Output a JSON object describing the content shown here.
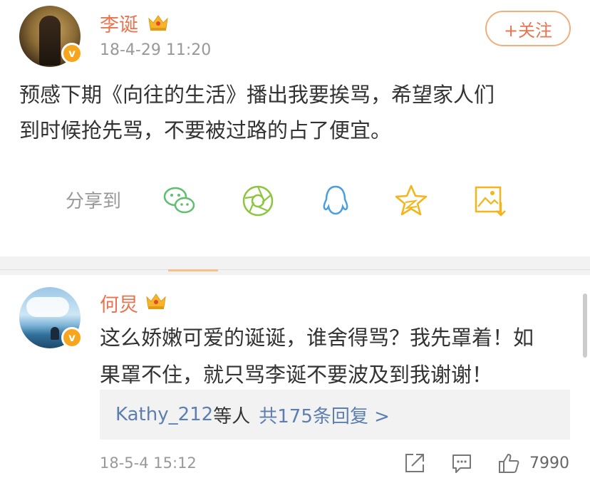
{
  "post": {
    "username": "李诞",
    "time": "18-4-29 11:20",
    "follow_label": "+关注",
    "text_line1": "预感下期《向往的生活》播出我要挨骂，希望家人们",
    "text_line2": "到时候抢先骂，不要被过路的占了便宜。",
    "verified_mark": "v",
    "share_label": "分享到",
    "share_icons": [
      "wechat-icon",
      "moments-icon",
      "qq-icon",
      "qzone-icon",
      "save-image-icon"
    ]
  },
  "comment": {
    "username": "何炅",
    "verified_mark": "v",
    "text_line1": "这么娇嫩可爱的诞诞，谁舍得骂？我先罩着！如",
    "text_line2": "果罩不住，就只骂李诞不要波及到我谢谢！",
    "reply_name": "Kathy_212",
    "reply_mid": "等人",
    "reply_count": "共175条回复 >",
    "time": "18-5-4 15:12",
    "like_count": "7990"
  },
  "colors": {
    "username": "#eb7350",
    "link": "#5d7fb0",
    "secondary": "#999999",
    "badge": "#f7a51c",
    "share_green": "#5fbf6e",
    "share_blue": "#4a9ee0",
    "share_yellow": "#f4b41a"
  }
}
